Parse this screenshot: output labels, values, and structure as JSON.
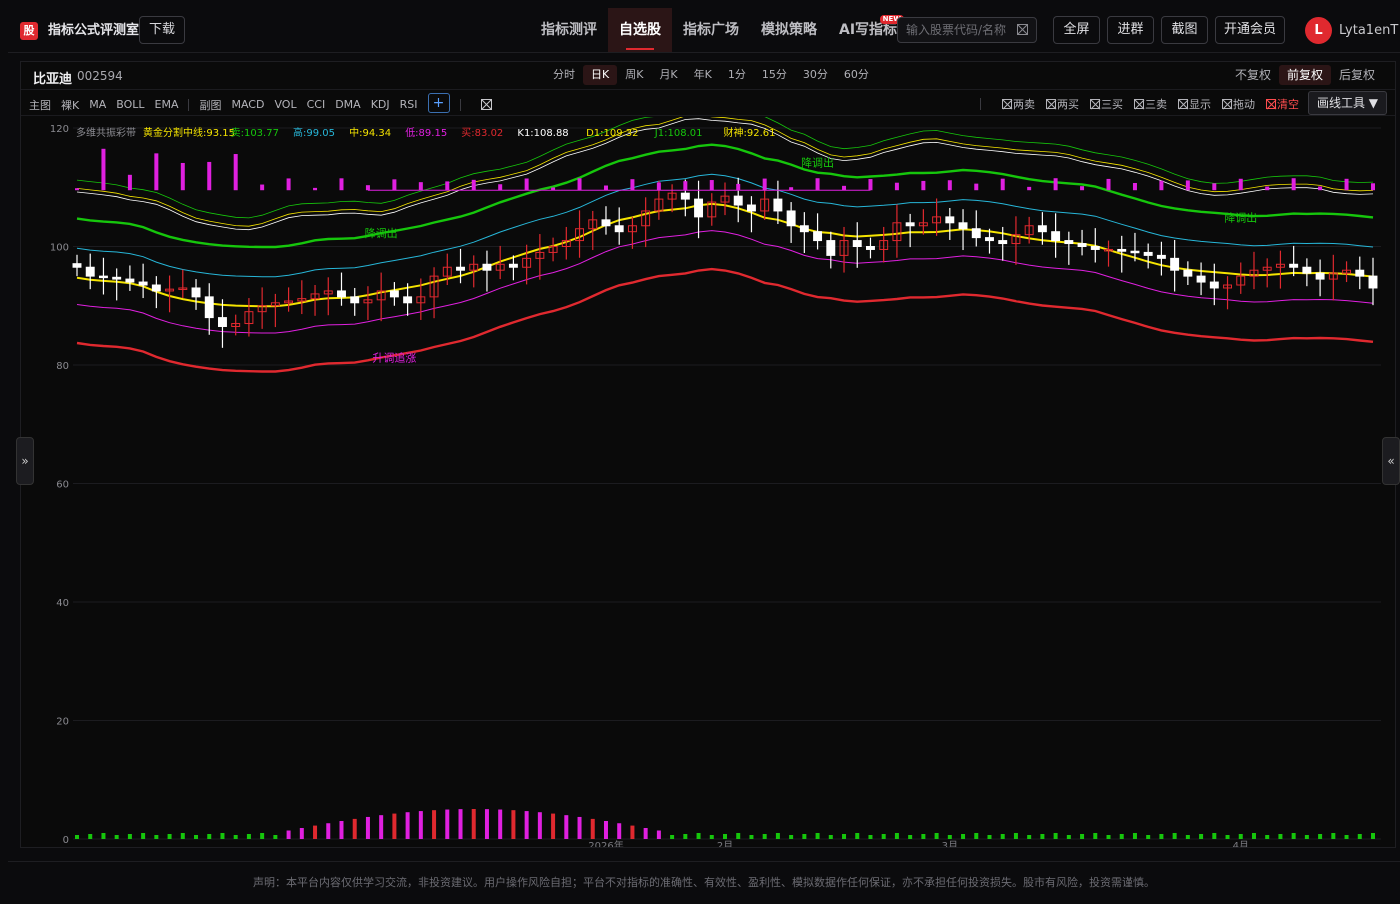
{
  "header": {
    "logo_text": "股",
    "app_title": "指标公式评测室",
    "download_label": "下载",
    "nav": [
      {
        "label": "指标测评",
        "active": false
      },
      {
        "label": "自选股",
        "active": true
      },
      {
        "label": "指标广场",
        "active": false
      },
      {
        "label": "模拟策略",
        "active": false
      },
      {
        "label": "AI写指标",
        "active": false,
        "badge": "NEW"
      }
    ],
    "search_placeholder": "输入股票代码/名称",
    "buttons": [
      "全屏",
      "进群",
      "截图",
      "开通会员"
    ],
    "avatar_letter": "L",
    "username": "Lyta1enT"
  },
  "stock": {
    "name": "比亚迪",
    "code": "002594"
  },
  "periods": [
    {
      "label": "分时",
      "active": false
    },
    {
      "label": "日K",
      "active": true
    },
    {
      "label": "周K",
      "active": false
    },
    {
      "label": "月K",
      "active": false
    },
    {
      "label": "年K",
      "active": false
    },
    {
      "label": "1分",
      "active": false
    },
    {
      "label": "15分",
      "active": false
    },
    {
      "label": "30分",
      "active": false
    },
    {
      "label": "60分",
      "active": false
    }
  ],
  "adjust": [
    {
      "label": "不复权",
      "active": false
    },
    {
      "label": "前复权",
      "active": true
    },
    {
      "label": "后复权",
      "active": false
    }
  ],
  "main_indicators": {
    "label": "主图",
    "items": [
      "裸K",
      "MA",
      "BOLL",
      "EMA"
    ]
  },
  "sub_indicators": {
    "label": "副图",
    "items": [
      "MACD",
      "VOL",
      "CCI",
      "DMA",
      "KDJ",
      "RSI"
    ]
  },
  "signals": [
    {
      "label": "两卖",
      "red": false
    },
    {
      "label": "两买",
      "red": false
    },
    {
      "label": "三买",
      "red": false
    },
    {
      "label": "三卖",
      "red": false
    },
    {
      "label": "显示",
      "red": false
    },
    {
      "label": "拖动",
      "red": false
    },
    {
      "label": "清空",
      "red": true
    }
  ],
  "draw_tool_label": "画线工具 ▼",
  "footer_text": "声明：本平台内容仅供学习交流，非投资建议。用户操作风险自担；平台不对指标的准确性、有效性、盈利性、模拟数据作任何保证，亦不承担任何投资损失。股市有风险，投资需谨慎。",
  "colors": {
    "up": "#e0292f",
    "down": "#ffffff",
    "green": "#16c60c",
    "yellow": "#f5e400",
    "magenta": "#e020e0",
    "cyan": "#27b6d8",
    "accent": "#e0292f"
  },
  "chart_data": {
    "type": "candlestick",
    "title": "多维共振彩带",
    "legend": [
      {
        "label": "黄金分割中线:93.15",
        "color": "#f5e400"
      },
      {
        "label": "卖:103.77",
        "color": "#16c60c"
      },
      {
        "label": "高:99.05",
        "color": "#27b6d8"
      },
      {
        "label": "中:94.34",
        "color": "#f5e400"
      },
      {
        "label": "低:89.15",
        "color": "#e020e0"
      },
      {
        "label": "买:83.02",
        "color": "#e0292f"
      },
      {
        "label": "K1:108.88",
        "color": "#ffffff"
      },
      {
        "label": "D1:109.32",
        "color": "#f5e400"
      },
      {
        "label": "J1:108.01",
        "color": "#16c60c"
      },
      {
        "label": "财神:92.61",
        "color": "#f5e400"
      }
    ],
    "y_ticks": [
      0,
      20,
      40,
      60,
      80,
      100,
      120
    ],
    "ylim": [
      0,
      120
    ],
    "x_labels": [
      "2026年",
      "2月",
      "3月",
      "4月"
    ],
    "annotations": [
      {
        "text": "降调出",
        "color": "#16c60c"
      },
      {
        "text": "降调出",
        "color": "#16c60c"
      },
      {
        "text": "降调出",
        "color": "#16c60c"
      },
      {
        "text": "升调追涨",
        "color": "#e020e0"
      }
    ],
    "closes": [
      96.5,
      95,
      94.8,
      94.5,
      94,
      93.5,
      92.5,
      92.8,
      93,
      91.5,
      88,
      86.5,
      87,
      89,
      90,
      90.5,
      90.8,
      91.2,
      92,
      92.5,
      91.5,
      90.5,
      91,
      92.5,
      91.5,
      90.5,
      91.5,
      95,
      96.5,
      96,
      97,
      96,
      97,
      96.5,
      98,
      99,
      100,
      101,
      103,
      104.5,
      103.5,
      102.5,
      103.5,
      106,
      108,
      109,
      108,
      105,
      107.5,
      108.5,
      107,
      106,
      108,
      106,
      103.5,
      102.5,
      101,
      98.5,
      101,
      100,
      99.5,
      101,
      104,
      103.5,
      104,
      105,
      104,
      103,
      101.5,
      101,
      100.5,
      102,
      103.5,
      102.5,
      101,
      100.5,
      100,
      99.5,
      99.5,
      99.2,
      99,
      98.5,
      98,
      96,
      95,
      94,
      93,
      93.5,
      95,
      96,
      96.5,
      97,
      96.5,
      95.5,
      94.5,
      95.5,
      96,
      95,
      93
    ]
  }
}
